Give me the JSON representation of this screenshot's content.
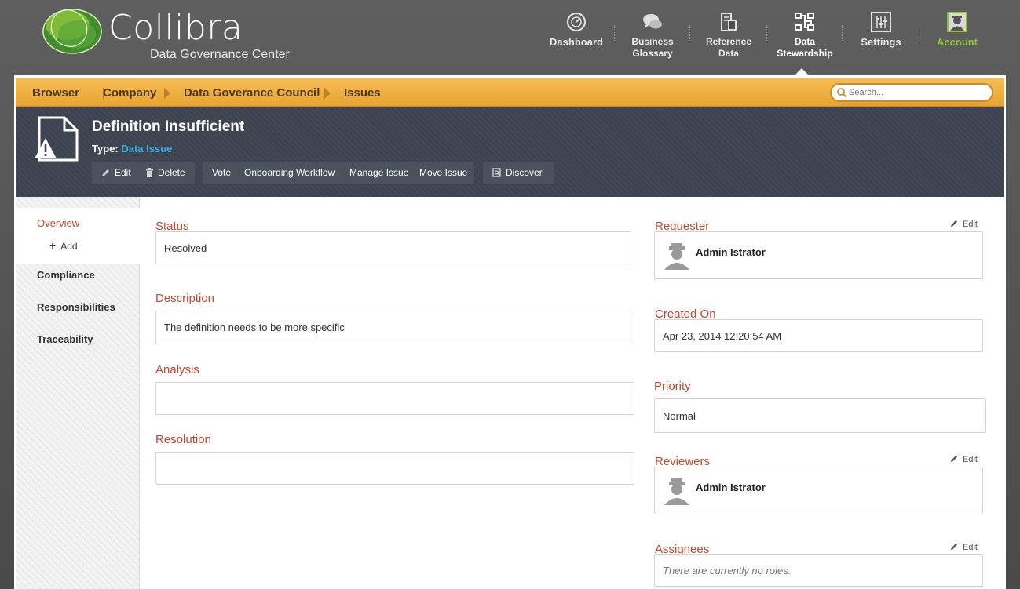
{
  "brand": {
    "name": "Collibra",
    "subtitle": "Data Governance Center"
  },
  "topnav": [
    {
      "label": "Dashboard",
      "icon": "dashboard-gauge-icon"
    },
    {
      "label": "Business\nGlossary",
      "icon": "speech-bubbles-icon"
    },
    {
      "label": "Reference\nData",
      "icon": "reference-data-icon"
    },
    {
      "label": "Data\nStewardship",
      "icon": "stewardship-icon",
      "active": true
    },
    {
      "label": "Settings",
      "icon": "sliders-icon"
    },
    {
      "label": "Account",
      "icon": "avatar-icon"
    }
  ],
  "breadcrumb": {
    "root": "Browser",
    "items": [
      "Company",
      "Data Goverance Council",
      "Issues"
    ]
  },
  "search": {
    "placeholder": "Search..."
  },
  "asset": {
    "title": "Definition Insufficient",
    "type_label": "Type:",
    "type_value": "Data Issue"
  },
  "actions": {
    "edit": "Edit",
    "delete": "Delete",
    "vote": "Vote",
    "onboarding": "Onboarding Workflow",
    "manage": "Manage Issue",
    "move": "Move Issue",
    "discover": "Discover"
  },
  "sidebar": {
    "overview": "Overview",
    "add": "Add",
    "items": [
      "Compliance",
      "Responsibilities",
      "Traceability"
    ]
  },
  "left_fields": {
    "status": {
      "label": "Status",
      "value": "Resolved"
    },
    "description": {
      "label": "Description",
      "value": "The definition needs to be more specific"
    },
    "analysis": {
      "label": "Analysis",
      "value": ""
    },
    "resolution": {
      "label": "Resolution",
      "value": ""
    }
  },
  "right_fields": {
    "requester": {
      "label": "Requester",
      "edit": "Edit",
      "person": "Admin Istrator"
    },
    "created_on": {
      "label": "Created On",
      "value": "Apr 23, 2014 12:20:54 AM"
    },
    "priority": {
      "label": "Priority",
      "value": "Normal"
    },
    "reviewers": {
      "label": "Reviewers",
      "edit": "Edit",
      "person": "Admin Istrator"
    },
    "assignees": {
      "label": "Assignees",
      "edit": "Edit",
      "empty": "There are currently no roles."
    }
  },
  "colors": {
    "accent_orange": "#e8a32f",
    "label_red": "#c6452c",
    "link_blue": "#3ab0e2",
    "account_green": "#8cc43c",
    "header_dark": "#3d4450"
  }
}
